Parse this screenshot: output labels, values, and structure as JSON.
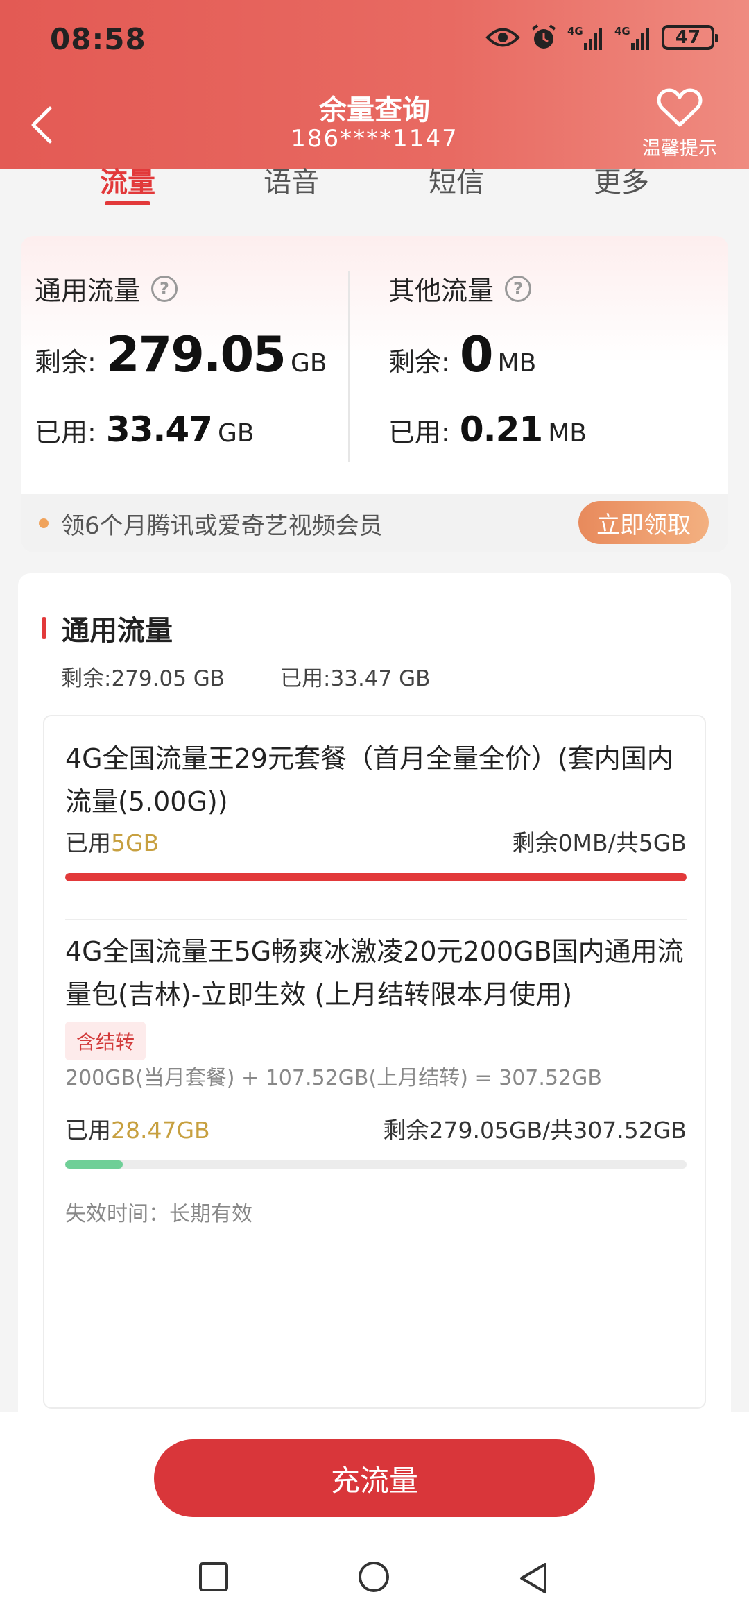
{
  "status_bar": {
    "time": "08:58",
    "battery": "47",
    "icons": [
      "eye-icon",
      "alarm-icon",
      "signal-4g-icon",
      "signal-4g-icon"
    ]
  },
  "header": {
    "title": "余量查询",
    "phone": "186****1147",
    "tips_label": "温馨提示"
  },
  "tabs": [
    {
      "label": "流量",
      "active": true
    },
    {
      "label": "语音",
      "active": false
    },
    {
      "label": "短信",
      "active": false
    },
    {
      "label": "更多",
      "active": false
    }
  ],
  "summary": {
    "general": {
      "title": "通用流量",
      "remain_label": "剩余:",
      "remain_value": "279.05",
      "remain_unit": "GB",
      "used_label": "已用:",
      "used_value": "33.47",
      "used_unit": "GB"
    },
    "other": {
      "title": "其他流量",
      "remain_label": "剩余:",
      "remain_value": "0",
      "remain_unit": "MB",
      "used_label": "已用:",
      "used_value": "0.21",
      "used_unit": "MB"
    },
    "promo_text": "领6个月腾讯或爱奇艺视频会员",
    "promo_button": "立即领取"
  },
  "detail": {
    "title": "通用流量",
    "remain_text": "剩余:279.05 GB",
    "used_text": "已用:33.47 GB",
    "packages": [
      {
        "name": "4G全国流量王29元套餐（首月全量全价）(套内国内流量(5.00G))",
        "used_label": "已用",
        "used_value": "5GB",
        "remain_text": "剩余0MB/共5GB",
        "progress": 1.0,
        "bar_color": "#e2393a"
      },
      {
        "name": "4G全国流量王5G畅爽冰激凌20元200GB国内通用流量包(吉林)-立即生效 (上月结转限本月使用)",
        "tag": "含结转",
        "formula": "200GB(当月套餐) + 107.52GB(上月结转) = 307.52GB",
        "used_label": "已用",
        "used_value": "28.47GB",
        "remain_text": "剩余279.05GB/共307.52GB",
        "progress": 0.0926,
        "bar_color": "#6fcf97",
        "expire_text": "失效时间：长期有效"
      }
    ]
  },
  "cta_label": "充流量",
  "nav": [
    "recent-apps-icon",
    "home-icon",
    "back-nav-icon"
  ]
}
